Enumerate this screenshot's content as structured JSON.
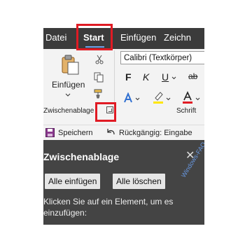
{
  "tabs": [
    {
      "label": "Datei"
    },
    {
      "label": "Start"
    },
    {
      "label": "Einfügen"
    },
    {
      "label": "Zeichn"
    }
  ],
  "ribbon": {
    "paste_label": "Einfügen",
    "clipboard_group_label": "Zwischenablage",
    "font_group_label": "Schrift",
    "font_name": "Calibri (Textkörper)",
    "format_buttons": [
      "F",
      "K",
      "U",
      "ab"
    ]
  },
  "quick_access": {
    "save_label": "Speichern",
    "undo_label": "Rückgängig: Eingabe"
  },
  "clipboard_pane": {
    "title": "Zwischenablage",
    "paste_all_label": "Alle einfügen",
    "clear_all_label": "Alle löschen",
    "info_text": "Klicken Sie auf ein Element, um es einzufügen:"
  },
  "watermark": "Windows-FAQ.de",
  "colors": {
    "tab_bar": "#3b3b3b",
    "ribbon": "#f3f3f3",
    "pane": "#444444",
    "highlight": "#e01b24",
    "accent": "#6fa1e8"
  }
}
